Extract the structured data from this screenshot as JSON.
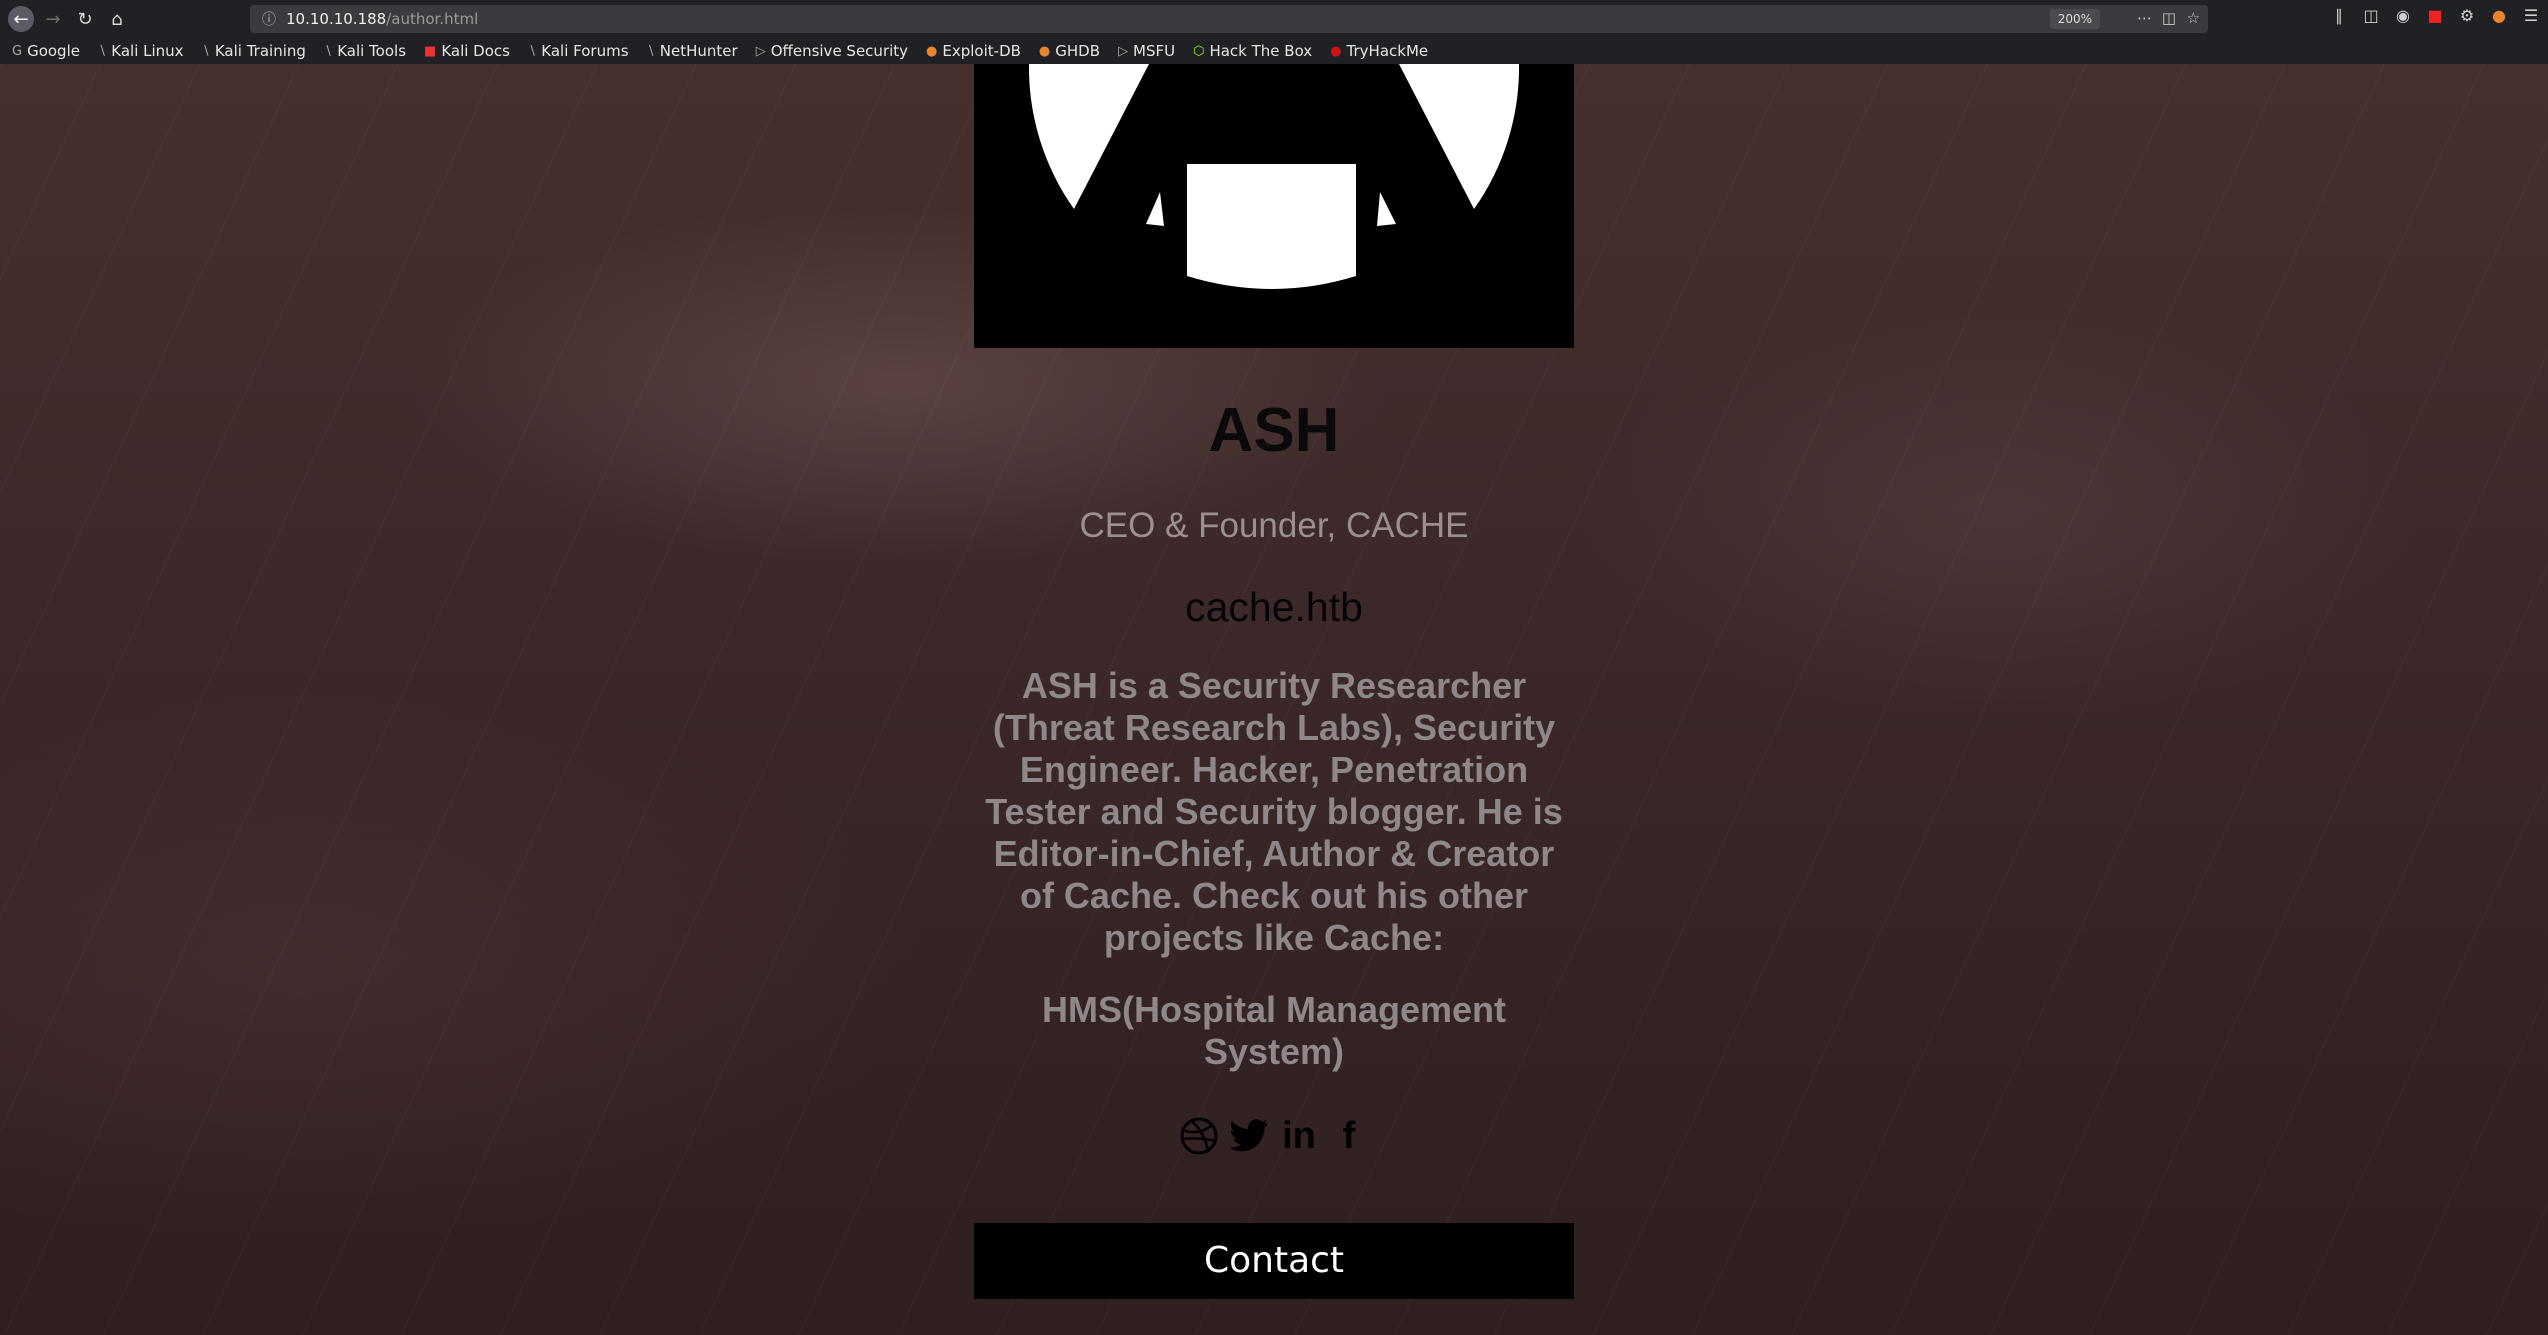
{
  "browser": {
    "url_host": "10.10.10.188",
    "url_path": "/author.html",
    "zoom": "200%",
    "bookmarks": [
      {
        "label": "Google",
        "icon": "google-icon"
      },
      {
        "label": "Kali Linux",
        "icon": "kali-icon"
      },
      {
        "label": "Kali Training",
        "icon": "kali-icon"
      },
      {
        "label": "Kali Tools",
        "icon": "kali-icon"
      },
      {
        "label": "Kali Docs",
        "icon": "kali-docs-icon"
      },
      {
        "label": "Kali Forums",
        "icon": "kali-icon"
      },
      {
        "label": "NetHunter",
        "icon": "kali-icon"
      },
      {
        "label": "Offensive Security",
        "icon": "offsec-icon"
      },
      {
        "label": "Exploit-DB",
        "icon": "exploitdb-icon"
      },
      {
        "label": "GHDB",
        "icon": "exploitdb-icon"
      },
      {
        "label": "MSFU",
        "icon": "offsec-icon"
      },
      {
        "label": "Hack The Box",
        "icon": "htb-icon"
      },
      {
        "label": "TryHackMe",
        "icon": "thm-icon"
      }
    ]
  },
  "author": {
    "name": "ASH",
    "role": "CEO & Founder, CACHE",
    "domain": "cache.htb",
    "bio": "ASH is a Security Researcher (Threat Research Labs), Security Engineer. Hacker, Penetration Tester and Security blogger. He is Editor-in-Chief, Author & Creator of Cache. Check out his other projects like Cache:",
    "project": "HMS(Hospital Management System)",
    "contact_label": "Contact",
    "socials": [
      {
        "name": "dribbble-icon",
        "glyph": ""
      },
      {
        "name": "twitter-icon",
        "glyph": ""
      },
      {
        "name": "linkedin-icon",
        "glyph": "in"
      },
      {
        "name": "facebook-icon",
        "glyph": "f"
      }
    ]
  },
  "colors": {
    "background": "#3a2627",
    "button": "#000000",
    "muted_text": "#8e8888"
  }
}
